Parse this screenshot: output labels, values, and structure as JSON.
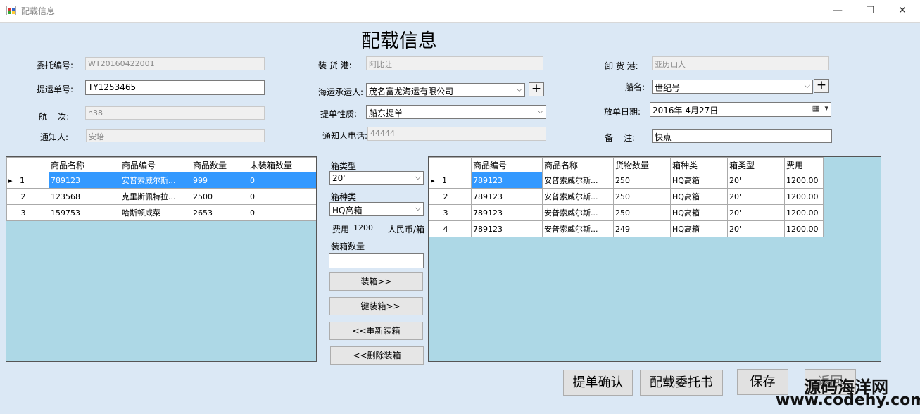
{
  "window": {
    "title": "配载信息",
    "minimize": "—",
    "maximize": "☐",
    "close": "✕"
  },
  "form_title": "配载信息",
  "fields": {
    "entrust_no_label": "委托编号:",
    "entrust_no": "WT20160422001",
    "bl_no_label": "提运单号:",
    "bl_no": "TY1253465",
    "voyage_label": "航    次:",
    "voyage": "h38",
    "notify_label": "通知人:",
    "notify": "安培",
    "load_port_label": "装 货 港:",
    "load_port": "阿比让",
    "carrier_label": "海运承运人:",
    "carrier": "茂名富龙海运有限公司",
    "bl_type_label": "提单性质:",
    "bl_type": "船东提单",
    "notify_phone_label": "通知人电话:",
    "notify_phone": "44444",
    "discharge_port_label": "卸 货 港:",
    "discharge_port": "亚历山大",
    "ship_label": "船名:",
    "ship": "世纪号",
    "release_date_label": "放单日期:",
    "release_date": "2016年 4月27日",
    "remark_label": "备    注:",
    "remark": "快点"
  },
  "left_grid": {
    "headers": [
      "",
      "商品名称",
      "商品编号",
      "商品数量",
      "未装箱数量"
    ],
    "rows": [
      {
        "row_no": "1",
        "cells": [
          "789123",
          "安普索威尔斯...",
          "999",
          "0"
        ]
      },
      {
        "row_no": "2",
        "cells": [
          "123568",
          "克里斯佩特拉...",
          "2500",
          "0"
        ]
      },
      {
        "row_no": "3",
        "cells": [
          "159753",
          "哈斯顿咸菜",
          "2653",
          "0"
        ]
      }
    ]
  },
  "middle": {
    "box_type_label": "箱类型",
    "box_type": "20'",
    "box_kind_label": "箱种类",
    "box_kind": "HQ高箱",
    "fee_label": "费用",
    "fee": "1200",
    "fee_unit": "人民币/箱",
    "qty_label": "装箱数量",
    "qty_value": "",
    "btn_pack": "装箱>>",
    "btn_pack_all": "一键装箱>>",
    "btn_repack": "<<重新装箱",
    "btn_delete": "<<删除装箱"
  },
  "right_grid": {
    "headers": [
      "",
      "商品编号",
      "商品名称",
      "货物数量",
      "箱种类",
      "箱类型",
      "费用"
    ],
    "rows": [
      {
        "row_no": "1",
        "cells": [
          "789123",
          "安普索威尔斯...",
          "250",
          "HQ高箱",
          "20'",
          "1200.00"
        ]
      },
      {
        "row_no": "2",
        "cells": [
          "789123",
          "安普索威尔斯...",
          "250",
          "HQ高箱",
          "20'",
          "1200.00"
        ]
      },
      {
        "row_no": "3",
        "cells": [
          "789123",
          "安普索威尔斯...",
          "250",
          "HQ高箱",
          "20'",
          "1200.00"
        ]
      },
      {
        "row_no": "4",
        "cells": [
          "789123",
          "安普索威尔斯...",
          "249",
          "HQ高箱",
          "20'",
          "1200.00"
        ]
      }
    ]
  },
  "actions": {
    "confirm_bl": "提单确认",
    "entrust_doc": "配载委托书",
    "save": "保存",
    "back": "返回"
  },
  "watermark": {
    "line1": "源码海洋网",
    "line2": "www.codehy.com"
  }
}
